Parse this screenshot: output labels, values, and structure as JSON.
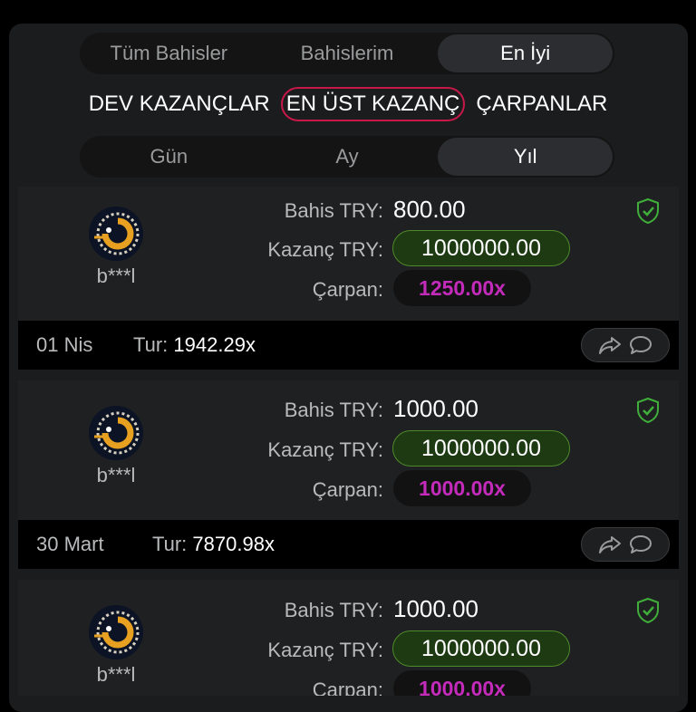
{
  "tabs": [
    {
      "label": "Tüm Bahisler",
      "active": false
    },
    {
      "label": "Bahislerim",
      "active": false
    },
    {
      "label": "En İyi",
      "active": true
    }
  ],
  "subnav": [
    {
      "label": "DEV KAZANÇLAR",
      "active": false
    },
    {
      "label": "EN ÜST KAZANÇ",
      "active": true
    },
    {
      "label": "ÇARPANLAR",
      "active": false
    }
  ],
  "periods": [
    {
      "label": "Gün",
      "active": false
    },
    {
      "label": "Ay",
      "active": false
    },
    {
      "label": "Yıl",
      "active": true
    }
  ],
  "labels": {
    "bet": "Bahis TRY:",
    "win": "Kazanç TRY:",
    "mult": "Çarpan:",
    "round": "Tur:"
  },
  "colors": {
    "accent_red": "#c8184a",
    "win_green": "#4f8a2b",
    "mult_magenta": "#c42bbb",
    "shield_green": "#3fae3a"
  },
  "bets": [
    {
      "user": "b***l",
      "bet": "800.00",
      "win": "1000000.00",
      "mult": "1250.00x",
      "date": "01 Nis",
      "round": "1942.29x"
    },
    {
      "user": "b***l",
      "bet": "1000.00",
      "win": "1000000.00",
      "mult": "1000.00x",
      "date": "30 Mart",
      "round": "7870.98x"
    },
    {
      "user": "b***l",
      "bet": "1000.00",
      "win": "1000000.00",
      "mult": "1000.00x"
    }
  ],
  "icons": {
    "verified": "shield-check-icon",
    "share": "share-icon",
    "chat": "chat-bubble-icon"
  }
}
